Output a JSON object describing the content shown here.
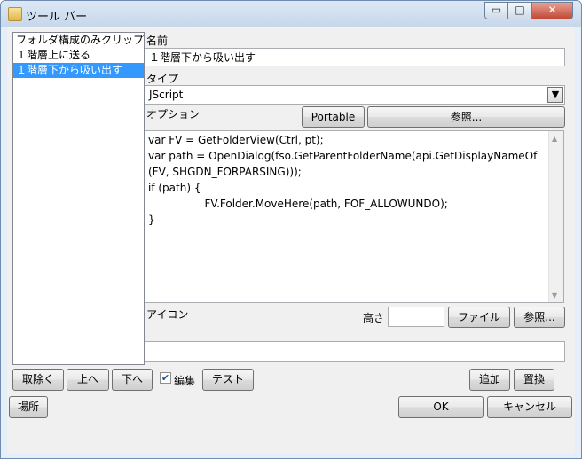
{
  "window": {
    "title": "ツール バー",
    "controls": {
      "minimize": "▭",
      "maximize": "□",
      "close": "✕"
    }
  },
  "list": {
    "items": [
      {
        "label": "フォルダ構成のみクリップ",
        "selected": false
      },
      {
        "label": "１階層上に送る",
        "selected": false
      },
      {
        "label": "１階層下から吸い出す",
        "selected": true
      }
    ]
  },
  "form": {
    "name_label": "名前",
    "name_value": "１階層下から吸い出す",
    "type_label": "タイプ",
    "type_value": "JScript",
    "options_label": "オプション",
    "portable_button": "Portable",
    "browse_button": "参照...",
    "code_lines": [
      "var FV = GetFolderView(Ctrl, pt);",
      "var path = OpenDialog(fso.GetParentFolderName(api.GetDisplayNameOf",
      "(FV, SHGDN_FORPARSING)));",
      "if (path) {",
      "\tFV.Folder.MoveHere(path, FOF_ALLOWUNDO);",
      "}"
    ],
    "icon_label": "アイコン",
    "height_label": "高さ",
    "height_value": "",
    "file_button": "ファイル",
    "icon_browse_button": "参照...",
    "icon_path_value": ""
  },
  "buttons": {
    "remove": "取除く",
    "up": "上へ",
    "down": "下へ",
    "edit_checkbox_label": "編集",
    "edit_checked": true,
    "test": "テスト",
    "add": "追加",
    "replace": "置換",
    "location": "場所",
    "ok": "OK",
    "cancel": "キャンセル"
  },
  "colors": {
    "selection": "#3399ff",
    "dialog_background": "#f0f0f0"
  }
}
